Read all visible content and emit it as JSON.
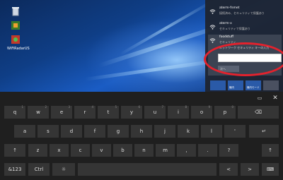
{
  "desktop": {
    "icons": [
      {
        "name": "recycle-bin",
        "label": ""
      },
      {
        "name": "app-icon",
        "label": ""
      },
      {
        "name": "app-icon-2",
        "label": "WiFiRadarUS"
      }
    ]
  },
  "wifi_flyout": {
    "networks": [
      {
        "ssid": "aterm-fnmet",
        "status": "接続済み、セキュリティで保護あり"
      },
      {
        "ssid": "aterm-x",
        "status": "セキュリティで保護あり"
      },
      {
        "ssid": "foodstuff",
        "status": "セキュリティ..."
      }
    ],
    "password_label": "ネットワーク セキュリティ キーの入力",
    "password_value": "",
    "next_label": "次へ",
    "quick_actions": [
      "",
      "機内",
      "機内モード",
      ""
    ]
  },
  "keyboard": {
    "row1": [
      "q",
      "w",
      "e",
      "r",
      "t",
      "y",
      "u",
      "i",
      "o",
      "p"
    ],
    "row1_subs": [
      "1",
      "2",
      "3",
      "4",
      "5",
      "6",
      "7",
      "8",
      "9",
      "0"
    ],
    "backspace": "⌫",
    "row2": [
      "a",
      "s",
      "d",
      "f",
      "g",
      "h",
      "j",
      "k",
      "l",
      "'"
    ],
    "enter": "↵",
    "shift": "↑",
    "row3": [
      "z",
      "x",
      "c",
      "v",
      "b",
      "n",
      "m",
      ",",
      ".",
      "?"
    ],
    "shift_right": "↑",
    "symbols": "&123",
    "ctrl": "Ctrl",
    "emoji": "☼",
    "left": "<",
    "right": ">",
    "keyboard_icon": "⌨",
    "close": "✕",
    "kb_menu": "▭"
  },
  "colors": {
    "highlight": "#e3222d",
    "accent": "#1a5cc4"
  }
}
